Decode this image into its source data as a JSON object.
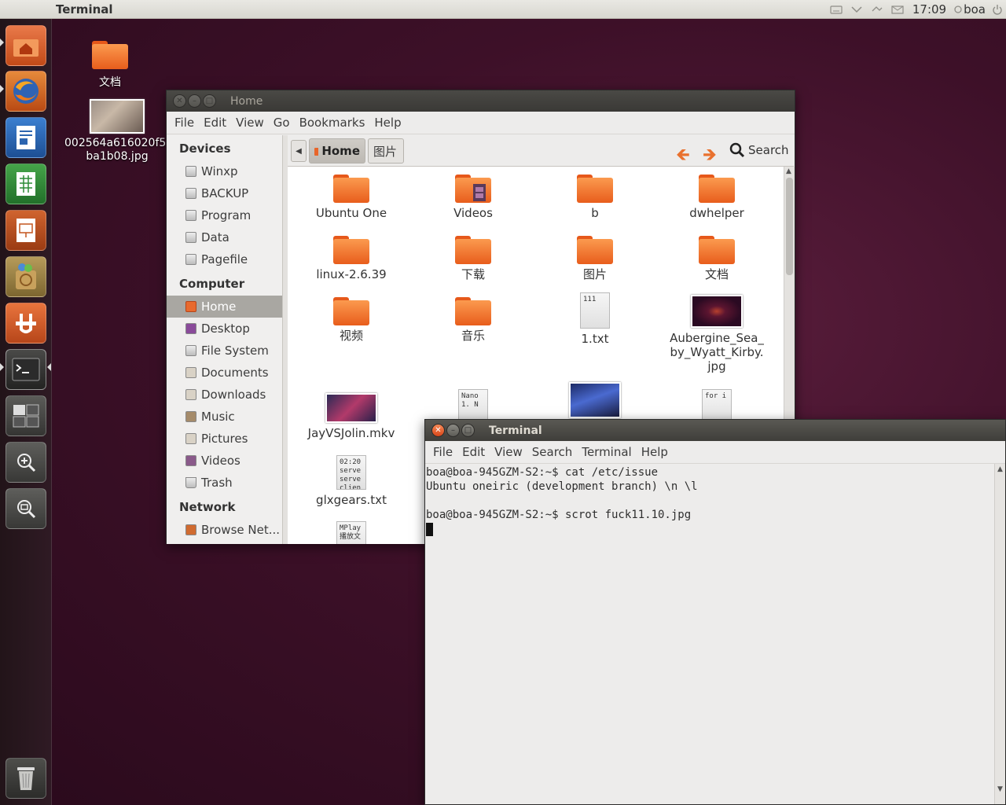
{
  "top_panel": {
    "app_title": "Terminal",
    "clock": "17:09",
    "user": "boa"
  },
  "launcher": {
    "items": [
      "home-folder",
      "firefox",
      "libreoffice-writer",
      "libreoffice-calc",
      "libreoffice-impress",
      "ubuntu-software-center",
      "ubuntu-one",
      "terminal",
      "workspace-switcher",
      "zoom-in",
      "zoom-out",
      "trash"
    ]
  },
  "desktop": {
    "icons": [
      {
        "label": "文档"
      },
      {
        "label": "002564a616020f5bba1b08.jpg",
        "line1": "002564a616020f5b",
        "line2": "ba1b08.jpg"
      }
    ]
  },
  "file_manager": {
    "title": "Home",
    "menu": [
      "File",
      "Edit",
      "View",
      "Go",
      "Bookmarks",
      "Help"
    ],
    "sidebar": {
      "devices_heading": "Devices",
      "devices": [
        "Winxp",
        "BACKUP",
        "Program",
        "Data",
        "Pagefile"
      ],
      "computer_heading": "Computer",
      "computer": [
        "Home",
        "Desktop",
        "File System",
        "Documents",
        "Downloads",
        "Music",
        "Pictures",
        "Videos",
        "Trash"
      ],
      "network_heading": "Network",
      "network": [
        "Browse Net..."
      ]
    },
    "breadcrumbs": {
      "current": "Home",
      "next": "图片"
    },
    "search_label": "Search",
    "files": [
      {
        "name": "Ubuntu One",
        "kind": "folder"
      },
      {
        "name": "Videos",
        "kind": "folder"
      },
      {
        "name": "b",
        "kind": "folder"
      },
      {
        "name": "dwhelper",
        "kind": "folder"
      },
      {
        "name": "linux-2.6.39",
        "kind": "folder"
      },
      {
        "name": "下载",
        "kind": "folder"
      },
      {
        "name": "图片",
        "kind": "folder"
      },
      {
        "name": "文档",
        "kind": "folder"
      },
      {
        "name": "视频",
        "kind": "folder"
      },
      {
        "name": "音乐",
        "kind": "folder"
      },
      {
        "name": "1.txt",
        "kind": "text",
        "preview": "111"
      },
      {
        "name": "Aubergine_Sea_by_Wyatt_Kirby.jpg",
        "line1": "Aubergine_Sea_",
        "line2": "by_Wyatt_Kirby.",
        "line3": "jpg",
        "kind": "image"
      },
      {
        "name": "JayVSJolin.mkv",
        "kind": "video"
      },
      {
        "name": "",
        "kind": "text",
        "preview": "Nano\n1. N"
      },
      {
        "name": "",
        "kind": "video"
      },
      {
        "name": "",
        "kind": "text",
        "preview": "for i"
      },
      {
        "name": "glxgears.txt",
        "kind": "text",
        "preview": "02:20\nserve\nserve\nclien"
      },
      {
        "name": "",
        "kind": "text",
        "preview": "MPlay\n播放文"
      }
    ]
  },
  "terminal": {
    "title": "Terminal",
    "menu": [
      "File",
      "Edit",
      "View",
      "Search",
      "Terminal",
      "Help"
    ],
    "lines": [
      "boa@boa-945GZM-S2:~$ cat /etc/issue",
      "Ubuntu oneiric (development branch) \\n \\l",
      "",
      "boa@boa-945GZM-S2:~$ scrot fuck11.10.jpg"
    ]
  }
}
